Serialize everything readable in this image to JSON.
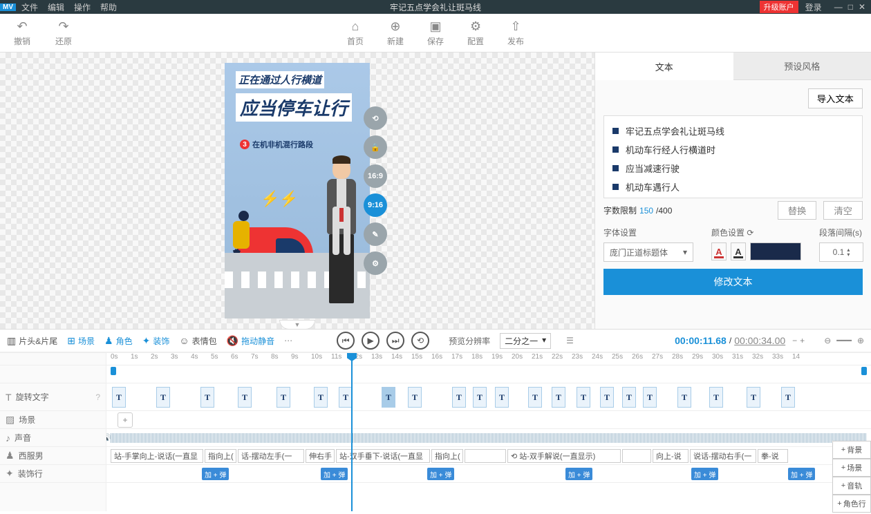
{
  "titlebar": {
    "logo": "MV",
    "menus": [
      "文件",
      "编辑",
      "操作",
      "帮助"
    ],
    "title": "牢记五点学会礼让斑马线",
    "upgrade": "升级账户",
    "login": "登录"
  },
  "toolbar": {
    "undo": "撤销",
    "redo": "还原",
    "home": "首页",
    "new": "新建",
    "save": "保存",
    "config": "配置",
    "publish": "发布"
  },
  "canvas": {
    "line1": "正在通过人行横道",
    "line2": "应当停车让行",
    "line3_num": "3",
    "line3_txt": "在机非机混行路段",
    "tools": {
      "ratio1": "16:9",
      "ratio2": "9:16"
    }
  },
  "panel": {
    "tabs": {
      "text": "文本",
      "preset": "预设风格"
    },
    "import": "导入文本",
    "items": [
      "牢记五点学会礼让斑马线",
      "机动车行经人行横道时",
      "应当减速行驶",
      "机动车遇行人"
    ],
    "count_label": "字数限制",
    "count_cur": "150",
    "count_max": "/400",
    "replace": "替换",
    "clear": "清空",
    "font_label": "字体设置",
    "color_label": "颜色设置",
    "gap_label": "段落间隔(s)",
    "font_name": "庞门正道标题体",
    "gap_value": "0.1",
    "color_hex": "#1a2a4a",
    "modify": "修改文本"
  },
  "tlbar": {
    "head_tail": "片头&片尾",
    "scene": "场景",
    "role": "角色",
    "decor": "装饰",
    "emoji": "表情包",
    "mute": "拖动静音",
    "preview_label": "预览分辨率",
    "preview_value": "二分之一",
    "time_cur": "00:00:11.68",
    "time_sep": "/",
    "time_total": "00:00:34.00"
  },
  "tracks": {
    "ruler": [
      "0s",
      "1s",
      "2s",
      "3s",
      "4s",
      "5s",
      "6s",
      "7s",
      "8s",
      "9s",
      "10s",
      "11s",
      "12s",
      "13s",
      "14s",
      "15s",
      "16s",
      "17s",
      "18s",
      "19s",
      "20s",
      "21s",
      "22s",
      "23s",
      "24s",
      "25s",
      "26s",
      "27s",
      "28s",
      "29s",
      "30s",
      "31s",
      "32s",
      "33s",
      "14"
    ],
    "rotate_text": "旋转文字",
    "scene": "场景",
    "sound": "声音",
    "man": "西服男",
    "decor": "装饰行",
    "t_positions": [
      8,
      72,
      136,
      190,
      246,
      300,
      336,
      398,
      436,
      500,
      530,
      562,
      610,
      644,
      680,
      714,
      746,
      776,
      826,
      872,
      926,
      976
    ],
    "clips": [
      "站-手掌向上-说话(一直显",
      "指向上(",
      "话-摆动左手(一",
      "伸右手",
      "站-双手垂下-说话(一直显",
      "指向上(",
      "",
      "⟲ 站-双手解说(一直显示)",
      "",
      "向上-说",
      "说话-摆动右手(一",
      "拳-说"
    ],
    "clip_widths": [
      134,
      46,
      96,
      42,
      136,
      46,
      60,
      164,
      42,
      52,
      96,
      44
    ],
    "deco_pos": [
      138,
      310,
      464,
      664,
      846,
      986
    ],
    "deco_label": "加 + 弹"
  },
  "sidebtns": [
    "背景",
    "场景",
    "音轨",
    "角色行"
  ]
}
